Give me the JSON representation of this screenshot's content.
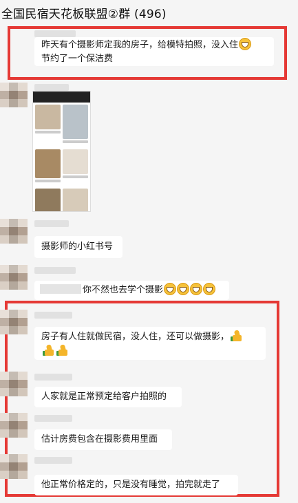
{
  "header": {
    "title": "全国民宿天花板联盟②群 (496)"
  },
  "messages": [
    {
      "text": "昨天有个摄影师定我的房子，给模特拍照，没入住",
      "text2": "节约了一个保洁费"
    },
    {
      "image": "screenshot-of-social-app-photo-grid"
    },
    {
      "text": "摄影师的小红书号"
    },
    {
      "text": "你不然也去学个摄影"
    },
    {
      "text": "房子有人住就做民宿，没人住，还可以做摄影，"
    },
    {
      "text": "人家就是正常预定给客户拍照的"
    },
    {
      "text": "估计房费包含在摄影费用里面"
    },
    {
      "text": "他正常价格定的，只是没有睡觉，拍完就走了"
    }
  ],
  "colors": {
    "highlight": "#e53935",
    "bubble": "#ffffff",
    "background": "#f5f5f5"
  },
  "icons": [
    "grinning-squint-emoji",
    "thumbs-up-emoji"
  ]
}
